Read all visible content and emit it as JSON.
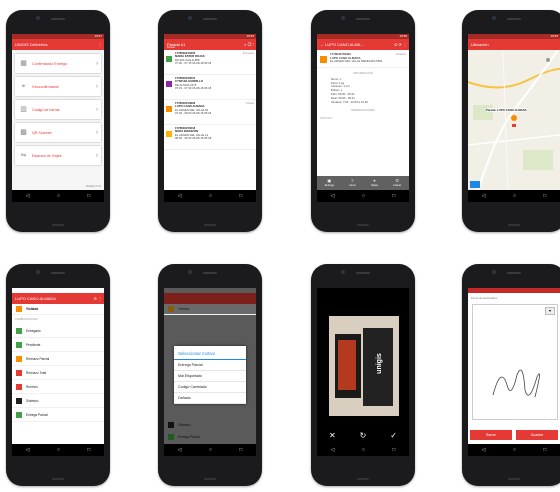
{
  "common": {
    "nav": {
      "back": "◁",
      "home": "○",
      "recent": "□"
    }
  },
  "s1": {
    "status": "19:57",
    "title": "UNIGIS Deliveries",
    "menu": [
      {
        "label": "Confirmación Entrega",
        "icon": "box-icon",
        "glyph": "▦"
      },
      {
        "label": "Geoconfirmación",
        "icon": "map-pin-icon",
        "glyph": "⌖"
      },
      {
        "label": "Código de barras",
        "icon": "barcode-icon",
        "glyph": "▥"
      },
      {
        "label": "QR Scanner",
        "icon": "qr-icon",
        "glyph": "▩"
      },
      {
        "label": "Estación de Viajes",
        "icon": "route-icon",
        "glyph": "⇋"
      }
    ],
    "footer": "Versión 3.7.0"
  },
  "s2": {
    "status": "19:55",
    "title": "Parada #1",
    "subtitle": "Parada",
    "items": [
      {
        "id": "1778646150305",
        "name": "MARIA ESTER ROJAS",
        "addr": "ROJAS CALLE 888",
        "time": "07:00 - 07:15",
        "date": "06-08-18 05:18",
        "state": "Entregado",
        "color": "#43a047"
      },
      {
        "id": "1778646150001",
        "name": "CYNTHIA GORDILLO",
        "addr": "DE ALSINA 2375",
        "time": "07:15 - 07:30",
        "date": "06-08-18 05:18",
        "state": "",
        "color": "#8e24aa"
      },
      {
        "id": "1778646150993",
        "name": "LUPO CANO ALMADA",
        "addr": "EL ARGEN DEL VALLE 54",
        "time": "07:30 - 08:00",
        "date": "06-08-18 05:18",
        "state": "Visitado",
        "color": "#fb8c00"
      },
      {
        "id": "1778646150218",
        "name": "NORA INFANZON",
        "addr": "EL ARGEN DEL VALLE 12",
        "time": "08:00 - 08:20",
        "date": "06-08-18 05:18",
        "state": "",
        "color": "#ffb300"
      }
    ]
  },
  "s3": {
    "status": "19:55",
    "title": "LUPO CANO ALMA...",
    "id": "1778646150993",
    "state": "Visitado",
    "name": "LUPO CANO ALMADA",
    "addr": "EL ARGEN DEL VALLE MENDOZA 5501",
    "info_header": "INFORMACIÓN",
    "info": [
      {
        "k": "Items",
        "v": "1"
      },
      {
        "k": "Peso",
        "v": "1 kg"
      },
      {
        "k": "Volumen",
        "v": "1 m3"
      },
      {
        "k": "Bultos",
        "v": "1"
      },
      {
        "k": "Plan",
        "v": "09:30 - 09:41"
      },
      {
        "k": "Real",
        "v": "09:30 - 09:41"
      },
      {
        "k": "Ventana",
        "v": "7:00 - 10:00 a 13:20"
      }
    ],
    "obs_header": "OBSERVACIONES",
    "photos": "FOTOS 0",
    "actions": [
      "Entrega",
      "Items",
      "Mapa",
      "Llamar"
    ]
  },
  "s4": {
    "status": "19:55",
    "title": "Ubicación",
    "marker": "Parada: LUPO CANO ALMADA"
  },
  "s5": {
    "title": "LUPO CANO ALMADA",
    "state": "Visitado",
    "section": "CAMBIAR ESTADO",
    "states": [
      {
        "label": "Entregado",
        "color": "#43a047"
      },
      {
        "label": "Pendiente",
        "color": "#43a047"
      },
      {
        "label": "Rechazo Parcial",
        "color": "#fb8c00"
      },
      {
        "label": "Rechazo Total",
        "color": "#e53935"
      },
      {
        "label": "Reenvío",
        "color": "#e53935"
      },
      {
        "label": "Siniestro",
        "color": "#212121"
      },
      {
        "label": "Entrega Parcial",
        "color": "#43a047"
      }
    ]
  },
  "s6": {
    "dialog_title": "Seleccionar motivo",
    "options": [
      "Entrega Parcial",
      "Mal Etiquetado",
      "Codigo Cambiado",
      "Dañado"
    ],
    "bg_labels": [
      "Visitado",
      "Siniestro",
      "Entrega Parcial"
    ]
  },
  "s7": {
    "brand": "unigis"
  },
  "s8": {
    "label": "Firma de destinatario",
    "buttons": [
      "Borrar",
      "Guardar"
    ]
  }
}
